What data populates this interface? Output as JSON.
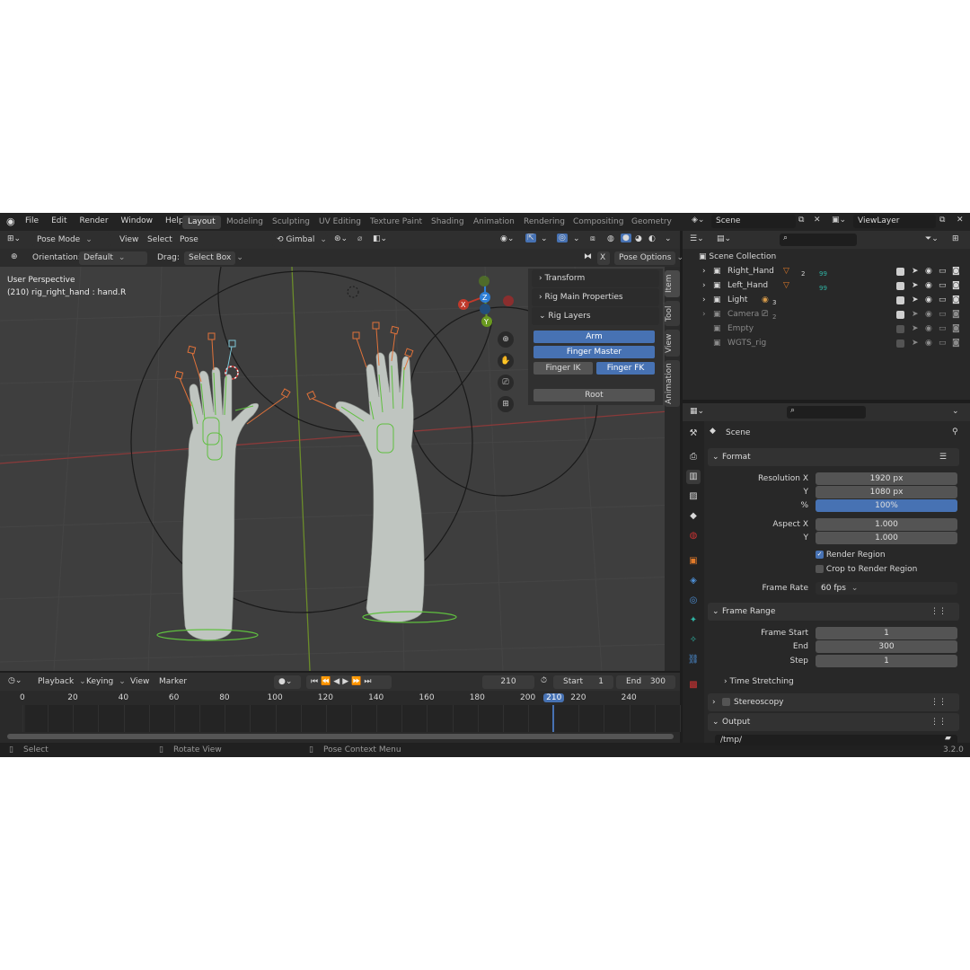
{
  "menu": [
    "File",
    "Edit",
    "Render",
    "Window",
    "Help"
  ],
  "workspaces": [
    "Layout",
    "Modeling",
    "Sculpting",
    "UV Editing",
    "Texture Paint",
    "Shading",
    "Animation",
    "Rendering",
    "Compositing",
    "Geometry Noc"
  ],
  "scene_name": "Scene",
  "view_layer": "ViewLayer",
  "viewport_header": {
    "mode": "Pose Mode",
    "menus": [
      "View",
      "Select",
      "Pose"
    ],
    "pivot": "Gimbal"
  },
  "tool_header": {
    "orientation_label": "Orientation:",
    "orientation_value": "Default",
    "drag_label": "Drag:",
    "drag_value": "Select Box",
    "x_mirror": "X",
    "pose_options": "Pose Options"
  },
  "viewport": {
    "perspective": "User Perspective",
    "active_info": "(210) rig_right_hand : hand.R",
    "gizmo": {
      "x": "X",
      "y": "Y",
      "z": "Z"
    }
  },
  "npanel": {
    "sections": [
      "Transform",
      "Rig Main Properties",
      "Rig Layers"
    ],
    "buttons": {
      "arm": "Arm",
      "finger_master": "Finger Master",
      "finger_ik": "Finger IK",
      "finger_fk": "Finger FK",
      "root": "Root"
    },
    "tabs": [
      "Item",
      "Tool",
      "View",
      "Animation"
    ]
  },
  "timeline": {
    "menus": [
      "Playback",
      "Keying",
      "View",
      "Marker"
    ],
    "current_frame": "210",
    "start_label": "Start",
    "start": "1",
    "end_label": "End",
    "end": "300",
    "ticks": [
      "0",
      "20",
      "40",
      "60",
      "80",
      "100",
      "120",
      "140",
      "160",
      "180",
      "200",
      "210",
      "220",
      "240"
    ]
  },
  "status": {
    "select": "Select",
    "rotate": "Rotate View",
    "context": "Pose Context Menu",
    "version": "3.2.0"
  },
  "outliner": {
    "root": "Scene Collection",
    "items": [
      {
        "name": "Right_Hand",
        "badge": "2",
        "badge2": "99"
      },
      {
        "name": "Left_Hand",
        "badge": "",
        "badge2": "99"
      },
      {
        "name": "Light",
        "badge": "3",
        "badge2": ""
      },
      {
        "name": "Camera",
        "badge": "2",
        "badge2": ""
      },
      {
        "name": "Empty",
        "badge": "",
        "badge2": ""
      },
      {
        "name": "WGTS_rig",
        "badge": "",
        "badge2": ""
      }
    ]
  },
  "properties": {
    "context": "Scene",
    "format_title": "Format",
    "res_x_label": "Resolution X",
    "res_x": "1920 px",
    "res_y_label": "Y",
    "res_y": "1080 px",
    "res_pct_label": "%",
    "res_pct": "100%",
    "res_pct_value": 1.0,
    "aspect_x_label": "Aspect X",
    "aspect_x": "1.000",
    "aspect_y_label": "Y",
    "aspect_y": "1.000",
    "render_region": "Render Region",
    "crop_region": "Crop to Render Region",
    "frame_rate_label": "Frame Rate",
    "frame_rate": "60 fps",
    "frame_range_title": "Frame Range",
    "frame_start_label": "Frame Start",
    "frame_start": "1",
    "frame_end_label": "End",
    "frame_end": "300",
    "frame_step_label": "Step",
    "frame_step": "1",
    "time_stretching": "Time Stretching",
    "stereoscopy": "Stereoscopy",
    "output": "Output",
    "output_path": "/tmp/"
  },
  "colors": {
    "accent_blue": "#4772b3",
    "axis_red": "#c0392b",
    "axis_green": "#6a9a1f",
    "bone_orange": "#e0723a",
    "bone_green": "#5fbf3f"
  }
}
